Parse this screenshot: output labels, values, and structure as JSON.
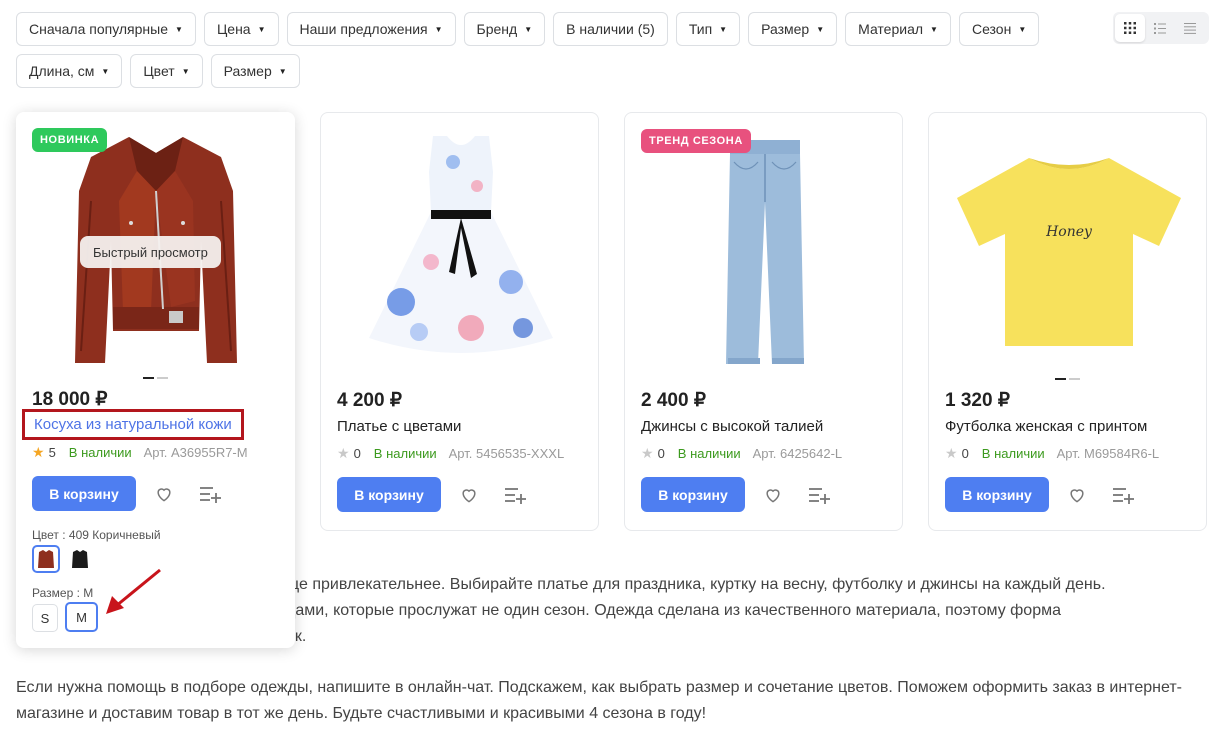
{
  "filters": [
    {
      "label": "Сначала популярные"
    },
    {
      "label": "Цена"
    },
    {
      "label": "Наши предложения"
    },
    {
      "label": "Бренд"
    },
    {
      "label": "В наличии (5)"
    },
    {
      "label": "Тип"
    },
    {
      "label": "Размер"
    },
    {
      "label": "Материал"
    },
    {
      "label": "Сезон"
    },
    {
      "label": "Длина, см"
    },
    {
      "label": "Цвет"
    },
    {
      "label": "Размер"
    }
  ],
  "view_modes": [
    {
      "icon": "grid-view-icon",
      "active": true
    },
    {
      "icon": "list-view-icon",
      "active": false
    },
    {
      "icon": "compact-list-icon",
      "active": false
    }
  ],
  "products": [
    {
      "badge": "НОВИНКА",
      "quick_view": "Быстрый просмотр",
      "price": "18 000 ₽",
      "title": "Косуха из натуральной кожи",
      "rating": "5",
      "stock": "В наличии",
      "article": "Арт. A36955R7-M",
      "cart_label": "В корзину",
      "color_label": "Цвет : 409 Коричневый",
      "size_label": "Размер : M",
      "sizes": [
        "S",
        "M"
      ]
    },
    {
      "price": "4 200 ₽",
      "title": "Платье с цветами",
      "rating": "0",
      "stock": "В наличии",
      "article": "Арт. 5456535-XXXL",
      "cart_label": "В корзину"
    },
    {
      "badge": "ТРЕНД СЕЗОНА",
      "price": "2 400 ₽",
      "title": "Джинсы с высокой талией",
      "rating": "0",
      "stock": "В наличии",
      "article": "Арт. 6425642-L",
      "cart_label": "В корзину"
    },
    {
      "price": "1 320 ₽",
      "title": "Футболка женская с принтом",
      "rating": "0",
      "stock": "В наличии",
      "article": "Арт. M69584R6-L",
      "cart_label": "В корзину",
      "print_text": "Honey"
    }
  ],
  "description": {
    "line1": "ще привлекательнее. Выбирайте платье для праздника, куртку на весну, футболку и джинсы на каждый день.",
    "line2": "дами, которые прослужат не один сезон. Одежда сделана из качественного материала, поэтому форма",
    "line3": "ок.",
    "paragraph2": "Если нужна помощь в подборе одежды, напишите в онлайн-чат. Подскажем, как выбрать размер и сочетание цветов. Поможем оформить заказ в интернет-магазине и доставим товар в тот же день. Будьте счастливыми и красивыми 4 сезона в году!"
  },
  "colors": {
    "accent": "#4e7ef1",
    "in_stock": "#3c9a1e",
    "badge_new": "#2ec95c",
    "badge_trend": "#e8517e",
    "highlight_frame": "#b3161d",
    "annotation_arrow": "#c8141b"
  }
}
